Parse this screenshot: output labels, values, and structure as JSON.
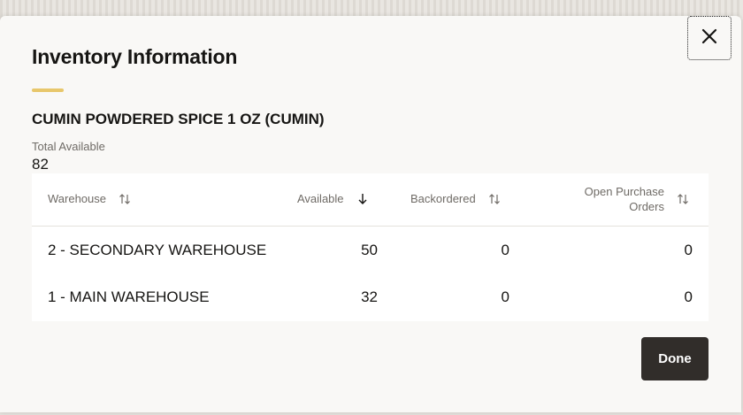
{
  "colors": {
    "accent": "#e8c76b",
    "primary_button": "#312d2a"
  },
  "dialog": {
    "title": "Inventory Information",
    "product_name": "CUMIN POWDERED SPICE 1 OZ (CUMIN)",
    "total_available_label": "Total Available",
    "total_available_value": "82",
    "close_icon": "close-icon",
    "done_label": "Done"
  },
  "table": {
    "columns": [
      {
        "label": "Warehouse",
        "sort_icon": "sort-both-icon"
      },
      {
        "label": "Available",
        "sort_icon": "sort-descending-icon"
      },
      {
        "label": "Backordered",
        "sort_icon": "sort-both-icon"
      },
      {
        "label_line1": "Open Purchase",
        "label_line2": "Orders",
        "sort_icon": "sort-both-icon"
      }
    ],
    "rows": [
      {
        "warehouse": "2 - SECONDARY WAREHOUSE",
        "available": "50",
        "backordered": "0",
        "open_po": "0"
      },
      {
        "warehouse": "1 - MAIN WAREHOUSE",
        "available": "32",
        "backordered": "0",
        "open_po": "0"
      }
    ]
  }
}
